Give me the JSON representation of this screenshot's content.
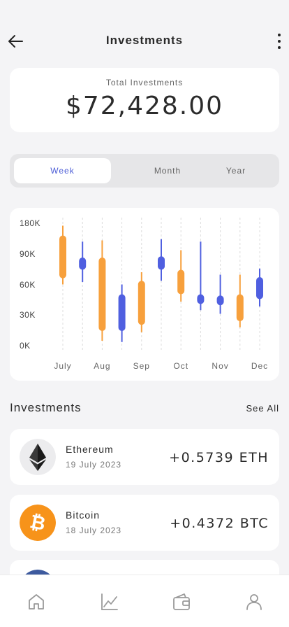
{
  "header": {
    "title": "Investments",
    "back_icon": "arrow-left-icon",
    "more_icon": "more-vertical-icon"
  },
  "total": {
    "label": "Total Investments",
    "value": "$72,428.00"
  },
  "period_tabs": {
    "week": "Week",
    "month": "Month",
    "year": "Year",
    "active": "Week"
  },
  "colors": {
    "up": "#f7a03c",
    "down": "#4f5fe0",
    "accent": "#4a5bd6"
  },
  "chart_data": {
    "type": "candlestick",
    "y_ticks": [
      "180K",
      "90K",
      "60K",
      "30K",
      "0K"
    ],
    "x_labels": [
      "July",
      "Aug",
      "Sep",
      "Oct",
      "Nov",
      "Dec"
    ],
    "candles": [
      {
        "open": 55,
        "close": 90,
        "high": 98,
        "low": 50,
        "color": "up"
      },
      {
        "open": 72,
        "close": 62,
        "high": 85,
        "low": 52,
        "color": "down"
      },
      {
        "open": 72,
        "close": 12,
        "high": 86,
        "low": 4,
        "color": "up"
      },
      {
        "open": 42,
        "close": 12,
        "high": 50,
        "low": 3,
        "color": "down"
      },
      {
        "open": 17,
        "close": 53,
        "high": 60,
        "low": 11,
        "color": "up"
      },
      {
        "open": 73,
        "close": 62,
        "high": 87,
        "low": 53,
        "color": "down"
      },
      {
        "open": 62,
        "close": 42,
        "high": 78,
        "low": 36,
        "color": "up"
      },
      {
        "open": 42,
        "close": 34,
        "high": 85,
        "low": 29,
        "color": "down"
      },
      {
        "open": 41,
        "close": 33,
        "high": 58,
        "low": 26,
        "color": "down"
      },
      {
        "open": 20,
        "close": 42,
        "high": 58,
        "low": 15,
        "color": "up"
      },
      {
        "open": 56,
        "close": 38,
        "high": 63,
        "low": 32,
        "color": "down"
      }
    ]
  },
  "investments": {
    "title": "Investments",
    "see_all": "See All",
    "items": [
      {
        "name": "Ethereum",
        "date": "19 July 2023",
        "amount": "+0.5739 ETH",
        "icon": "ethereum-icon"
      },
      {
        "name": "Bitcoin",
        "date": "18 July 2023",
        "amount": "+0.4372 BTC",
        "icon": "bitcoin-icon"
      }
    ]
  },
  "tabbar": {
    "icons": [
      "home-icon",
      "chart-icon",
      "wallet-icon",
      "profile-icon"
    ]
  }
}
